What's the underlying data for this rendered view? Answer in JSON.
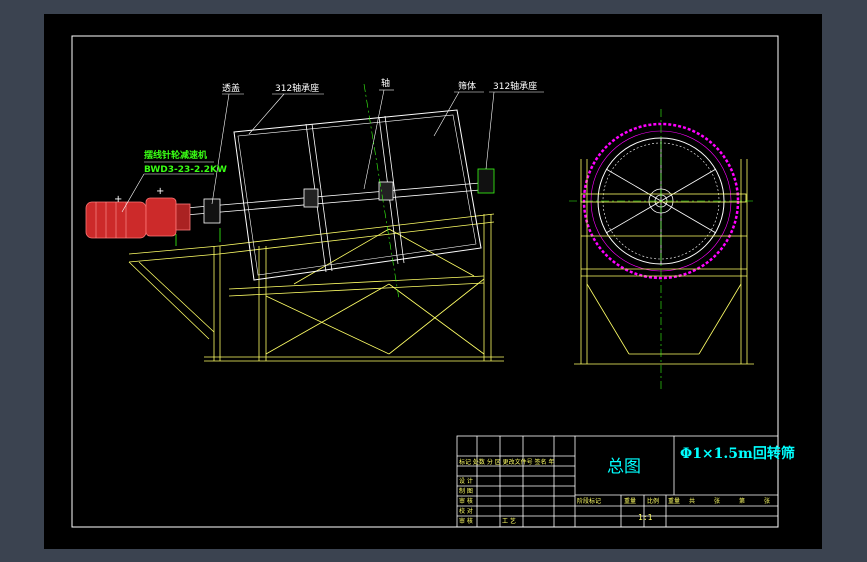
{
  "colors": {
    "app_background": "#3b4350",
    "canvas": "#000000",
    "frame": "#ffffff",
    "structure": "#ffff66",
    "centerline": "#39ff14",
    "screen_mesh": "#ff00ff",
    "title_text": "#00ffff"
  },
  "labels": {
    "cover": "透盖",
    "bearing_seat_left": "312轴承座",
    "shaft": "轴",
    "screen_body": "筛体",
    "bearing_seat_right": "312轴承座",
    "reducer_name": "摆线针轮减速机",
    "reducer_model": "BWD3-23-2.2KW"
  },
  "title_block": {
    "drawing_name": "总图",
    "product_name": "Φ1×1.5m回转筛",
    "scale": "1:1",
    "unit_line": "标记 处数 分 区 更改文件号  签名 年",
    "left_rows": [
      "设 计",
      "制 图",
      "审 核",
      "校 对",
      "审 核",
      "工 艺"
    ],
    "bottom_headers": [
      "阶段标记",
      "重量",
      "比例",
      "重量",
      "共",
      "张",
      "第",
      "张"
    ]
  }
}
